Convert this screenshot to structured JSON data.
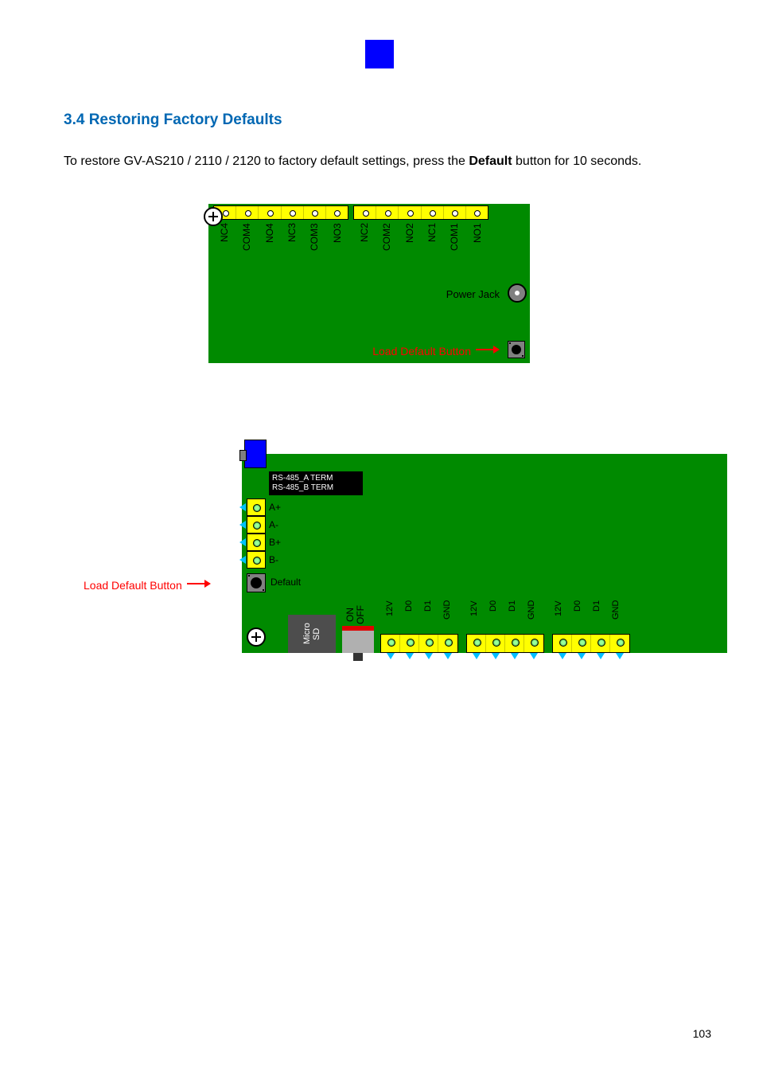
{
  "chapter_ref": "3",
  "section_title": "3.4 Restoring Factory Defaults",
  "body": {
    "before_default": "To restore GV-AS210 / 2110 / 2120 to factory default settings, press the ",
    "default_word": "Default",
    "after_default": " button for 10 seconds."
  },
  "diagram1": {
    "pin_block_left": [
      "NC4",
      "COM4",
      "NO4",
      "NC3",
      "COM3",
      "NO3"
    ],
    "pin_block_right": [
      "NC2",
      "COM2",
      "NO2",
      "NC1",
      "COM1",
      "NO1"
    ],
    "power_jack_label": "Power Jack",
    "load_default_label": "Load Default Button"
  },
  "diagram2": {
    "rs485_lines": [
      "RS-485_A TERM",
      "RS-485_B TERM"
    ],
    "side_terms": [
      "A+",
      "A-",
      "B+",
      "B-"
    ],
    "default_text": "Default",
    "microsd": "Micro\nSD",
    "onoff": "ON\nOFF",
    "load_default_label": "Load Default Button",
    "bottom_group": [
      "12V",
      "D0",
      "D1",
      "GND"
    ]
  },
  "page_number": "103"
}
